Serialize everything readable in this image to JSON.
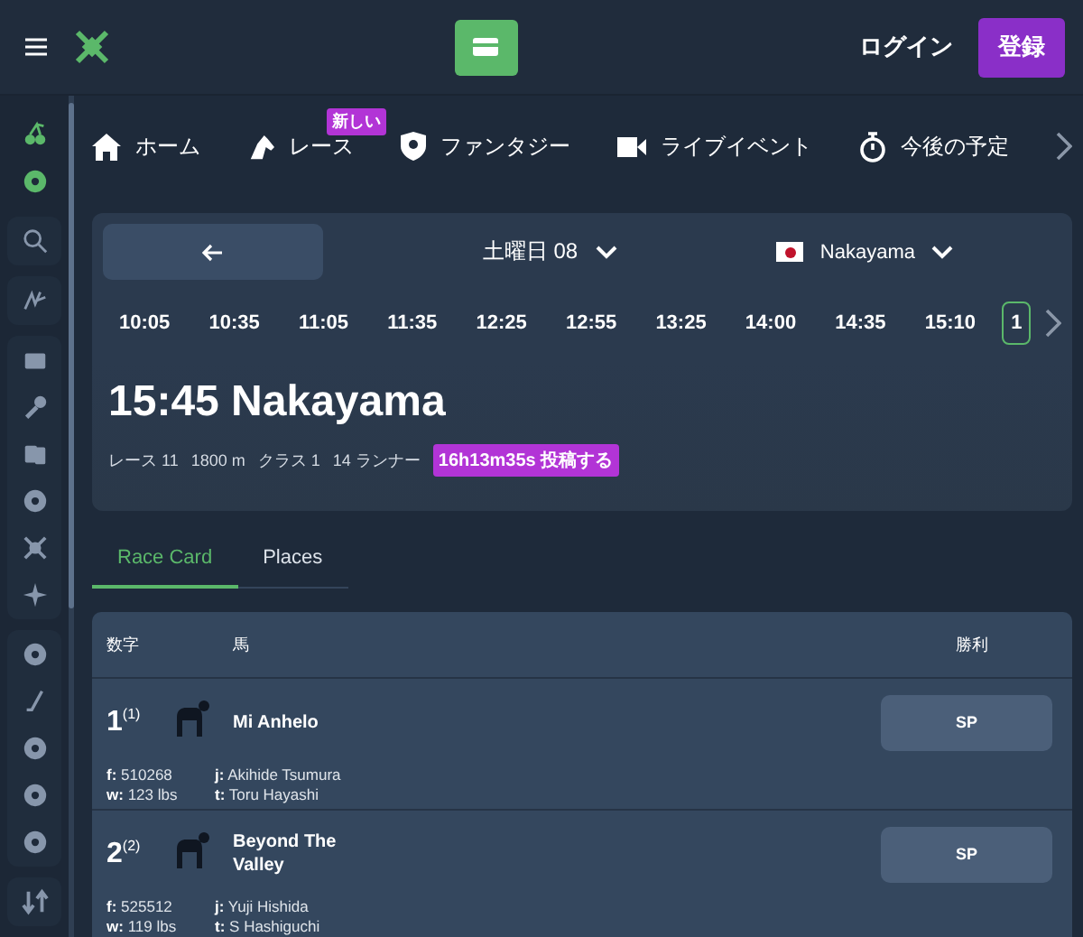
{
  "header": {
    "login": "ログイン",
    "register": "登録"
  },
  "sidebar": {
    "groups": [
      [
        {
          "kind": "cherry",
          "selected": true
        },
        {
          "kind": "ball",
          "selected": true
        }
      ],
      [
        {
          "kind": "search",
          "selected": false
        }
      ],
      [
        {
          "kind": "script",
          "selected": false
        }
      ],
      [
        {
          "kind": "grid",
          "selected": false
        },
        {
          "kind": "mic",
          "selected": false
        },
        {
          "kind": "cards",
          "selected": false
        },
        {
          "kind": "ball",
          "selected": false
        },
        {
          "kind": "cross",
          "selected": false
        },
        {
          "kind": "sparkle",
          "selected": false
        }
      ],
      [
        {
          "kind": "ball",
          "selected": false
        },
        {
          "kind": "stick",
          "selected": false
        },
        {
          "kind": "ball",
          "selected": false
        },
        {
          "kind": "ball",
          "selected": false
        },
        {
          "kind": "ball",
          "selected": false
        }
      ],
      [
        {
          "kind": "arrows",
          "selected": false
        }
      ]
    ]
  },
  "nav": [
    {
      "kind": "home",
      "label": "ホーム"
    },
    {
      "kind": "horse",
      "label": "レース",
      "badge": "新しい"
    },
    {
      "kind": "shield",
      "label": "ファンタジー"
    },
    {
      "kind": "video",
      "label": "ライブイベント"
    },
    {
      "kind": "timer",
      "label": "今後の予定"
    }
  ],
  "race_panel": {
    "day": "土曜日 08",
    "venue": "Nakayama",
    "times": [
      {
        "label": "10:05",
        "selected": false
      },
      {
        "label": "10:35",
        "selected": false
      },
      {
        "label": "11:05",
        "selected": false
      },
      {
        "label": "11:35",
        "selected": false
      },
      {
        "label": "12:25",
        "selected": false
      },
      {
        "label": "12:55",
        "selected": false
      },
      {
        "label": "13:25",
        "selected": false
      },
      {
        "label": "14:00",
        "selected": false
      },
      {
        "label": "14:35",
        "selected": false
      },
      {
        "label": "15:10",
        "selected": false
      },
      {
        "label": "1",
        "selected": true
      }
    ],
    "title": "15:45 Nakayama",
    "meta": [
      "レース 11",
      "1800 m",
      "クラス 1",
      "14 ランナー"
    ],
    "countdown": "16h13m35s 投稿する"
  },
  "tabs": [
    {
      "label": "Race Card",
      "selected": true
    },
    {
      "label": "Places",
      "selected": false
    }
  ],
  "table": {
    "columns": [
      "数字",
      "馬",
      "勝利"
    ],
    "rows": [
      {
        "number": "1",
        "draw": "(1)",
        "horse": "Mi Anhelo",
        "f": "**f:** 510268",
        "w": "**w:** 123 lbs",
        "j": "**j:** Akihide Tsumura",
        "t": "**t:** Toru Hayashi",
        "odds": "SP"
      },
      {
        "number": "2",
        "draw": "(2)",
        "horse": "Beyond The Valley",
        "f": "**f:** 525512",
        "w": "**w:** 119 lbs",
        "j": "**j:** Yuji Hishida",
        "t": "**t:** S Hashiguchi",
        "odds": "SP"
      }
    ]
  }
}
